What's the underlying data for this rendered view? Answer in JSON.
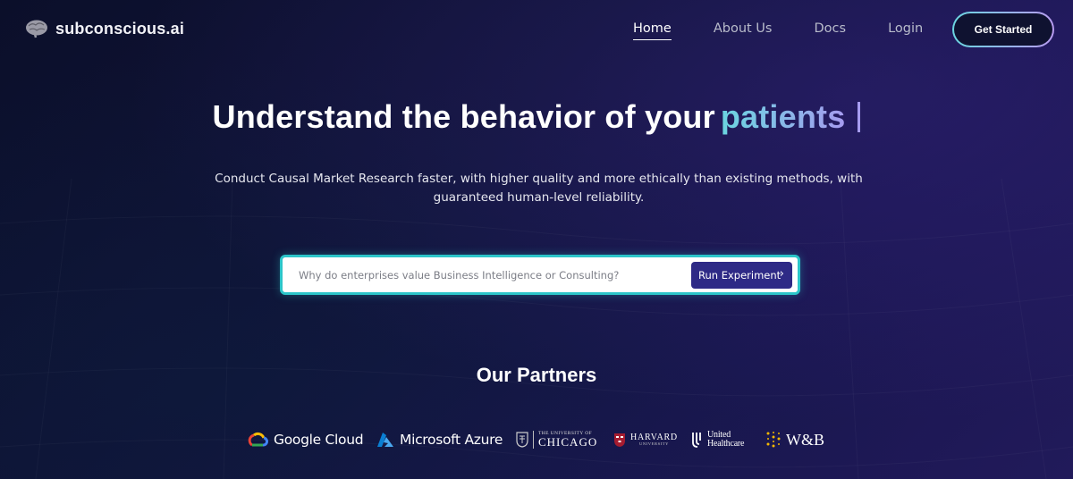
{
  "header": {
    "brand_name": "subconscious.ai",
    "nav": [
      {
        "label": "Home",
        "active": true
      },
      {
        "label": "About Us",
        "active": false
      },
      {
        "label": "Docs",
        "active": false
      },
      {
        "label": "Login",
        "active": false
      }
    ],
    "cta_label": "Get Started"
  },
  "hero": {
    "headline": "Understand the behavior of your",
    "headline_accent": "patients",
    "subtitle": "Conduct Causal Market Research faster, with higher quality and more ethically than existing methods, with guaranteed human-level reliability."
  },
  "search": {
    "placeholder": "Why do enterprises value Business Intelligence or Consulting?",
    "value": "",
    "button_label": "Run Experiment",
    "button_icon": "chevron-right-icon"
  },
  "partners": {
    "title": "Our Partners",
    "items": [
      {
        "name": "Google Cloud",
        "icon": "google-cloud-icon"
      },
      {
        "name": "Microsoft Azure",
        "icon": "azure-icon"
      },
      {
        "line1": "THE UNIVERSITY OF",
        "line2": "CHICAGO",
        "icon": "uchicago-crest-icon"
      },
      {
        "line1": "HARVARD",
        "line2": "UNIVERSITY",
        "icon": "harvard-shield-icon"
      },
      {
        "line1": "United",
        "line2": "Healthcare",
        "icon": "united-healthcare-icon"
      },
      {
        "name": "W&B",
        "icon": "wandb-dots-icon"
      }
    ]
  },
  "colors": {
    "accent_cyan": "#2cc5c9",
    "gradient_start": "#6ad5e0",
    "gradient_end": "#a69cf0",
    "button_primary": "#2e2a86"
  }
}
